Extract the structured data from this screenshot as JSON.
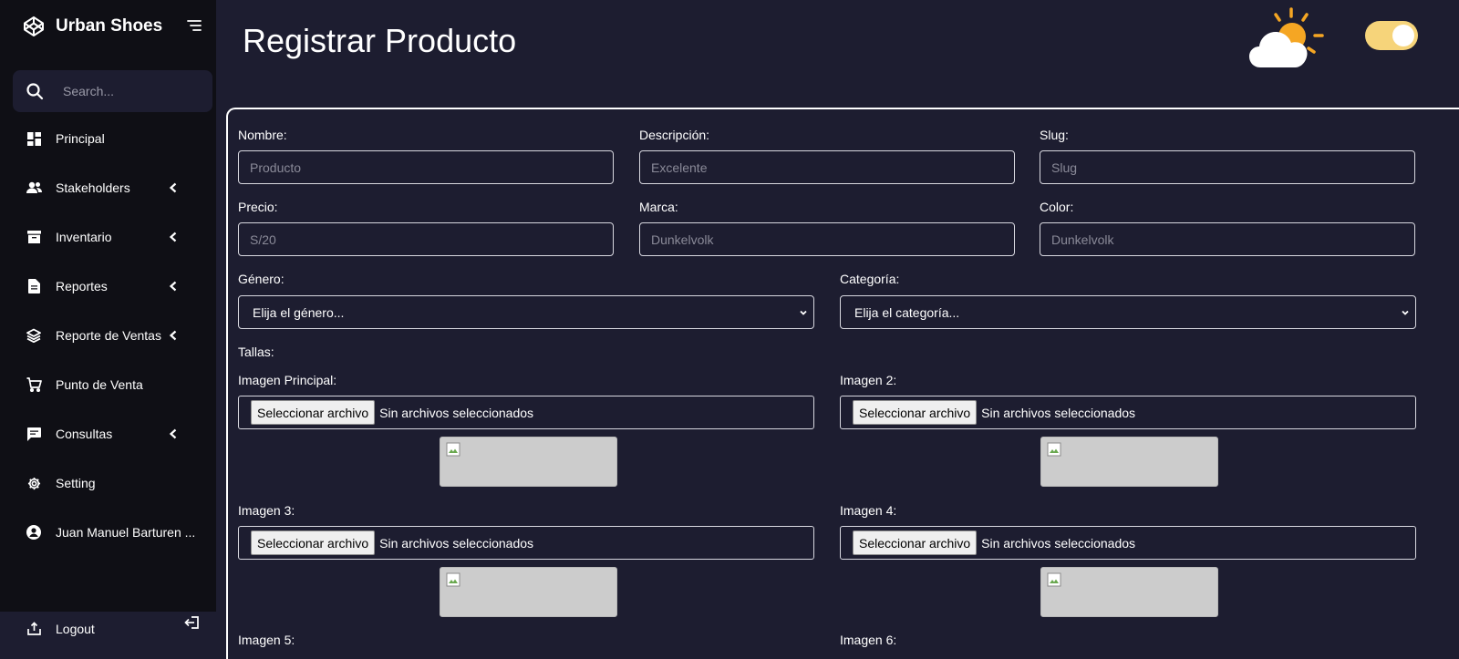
{
  "brand": {
    "name": "Urban Shoes"
  },
  "search": {
    "placeholder": "Search..."
  },
  "nav": [
    {
      "label": "Principal",
      "icon": "dashboard-icon",
      "has_submenu": false
    },
    {
      "label": "Stakeholders",
      "icon": "users-icon",
      "has_submenu": true
    },
    {
      "label": "Inventario",
      "icon": "archive-icon",
      "has_submenu": true
    },
    {
      "label": "Reportes",
      "icon": "file-icon",
      "has_submenu": true
    },
    {
      "label": "Reporte de Ventas",
      "icon": "layers-icon",
      "has_submenu": true
    },
    {
      "label": "Punto de Venta",
      "icon": "cart-icon",
      "has_submenu": false
    },
    {
      "label": "Consultas",
      "icon": "chat-icon",
      "has_submenu": true
    },
    {
      "label": "Setting",
      "icon": "gear-icon",
      "has_submenu": false
    },
    {
      "label": "Juan Manuel Barturen ...",
      "icon": "user-circle-icon",
      "has_submenu": false
    }
  ],
  "logout": {
    "label": "Logout"
  },
  "page": {
    "title": "Registrar Producto"
  },
  "theme_toggle": {
    "on": true,
    "color": "#f6d47a"
  },
  "form": {
    "nombre": {
      "label": "Nombre:",
      "placeholder": "Producto"
    },
    "descripcion": {
      "label": "Descripción:",
      "placeholder": "Excelente"
    },
    "slug": {
      "label": "Slug:",
      "placeholder": "Slug"
    },
    "precio": {
      "label": "Precio:",
      "placeholder": "S/20"
    },
    "marca": {
      "label": "Marca:",
      "placeholder": "Dunkelvolk"
    },
    "color": {
      "label": "Color:",
      "placeholder": "Dunkelvolk"
    },
    "genero": {
      "label": "Género:",
      "selected": "Elija el género..."
    },
    "categoria": {
      "label": "Categoría:",
      "selected": "Elija el categoría..."
    },
    "tallas": {
      "label": "Tallas:"
    },
    "images": [
      {
        "label": "Imagen Principal:",
        "button": "Seleccionar archivo",
        "status": "Sin archivos seleccionados"
      },
      {
        "label": "Imagen 2:",
        "button": "Seleccionar archivo",
        "status": "Sin archivos seleccionados"
      },
      {
        "label": "Imagen 3:",
        "button": "Seleccionar archivo",
        "status": "Sin archivos seleccionados"
      },
      {
        "label": "Imagen 4:",
        "button": "Seleccionar archivo",
        "status": "Sin archivos seleccionados"
      },
      {
        "label": "Imagen 5:"
      },
      {
        "label": "Imagen 6:"
      }
    ]
  },
  "colors": {
    "background": "#1d1d30",
    "sidebar": "#0f0f15",
    "accent": "#f6d47a"
  }
}
